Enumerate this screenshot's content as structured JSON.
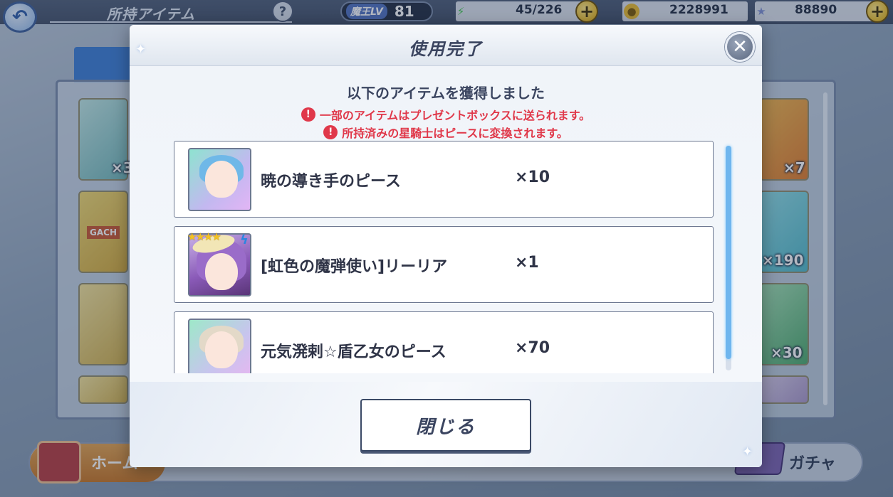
{
  "topbar": {
    "title": "所持アイテム",
    "help_label": "?",
    "level_label": "魔王LV",
    "level_value": "81",
    "stamina": "45/226",
    "coins": "2228991",
    "gems": "88890",
    "plus_label": "+"
  },
  "background": {
    "counts_left": [
      "×3"
    ],
    "counts_right": [
      "×7",
      "×190",
      "×30"
    ],
    "card_label": "GACH"
  },
  "nav": {
    "home_label": "ホーム",
    "gacha_label": "ガチャ"
  },
  "modal": {
    "title": "使用完了",
    "close_icon": "close-icon",
    "headline": "以下のアイテムを獲得しました",
    "notices": [
      "一部のアイテムはプレゼントボックスに送られます。",
      "所持済みの星騎士はピースに変換されます。"
    ],
    "notice_icon_glyph": "!",
    "items": [
      {
        "name": "暁の導き手のピース",
        "qty": "×10"
      },
      {
        "name": "[虹色の魔弾使い]リーリア",
        "qty": "×1"
      },
      {
        "name": "元気溌剌☆盾乙女のピース",
        "qty": "×70"
      }
    ],
    "close_button_label": "閉じる"
  },
  "colors": {
    "accent_text": "#3b4560",
    "warning": "#e0384a",
    "scroll_accent": "#6fb6ee"
  }
}
